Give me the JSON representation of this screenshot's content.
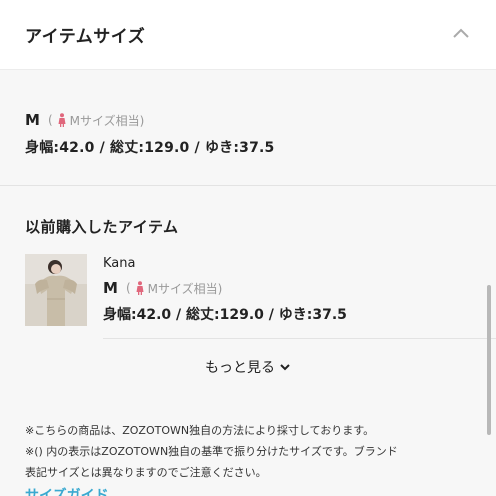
{
  "header": {
    "title": "アイテムサイズ",
    "toggle_icon": "chevron-up-icon"
  },
  "current_size": {
    "size": "M",
    "open_paren": "(",
    "equivalent": "Mサイズ相当)",
    "measurements": "身幅:42.0 / 総丈:129.0 / ゆき:37.5"
  },
  "previous": {
    "title": "以前購入したアイテム",
    "item": {
      "brand": "Kana",
      "size": "M",
      "open_paren": "(",
      "equivalent": "Mサイズ相当)",
      "measurements": "身幅:42.0 / 総丈:129.0 / ゆき:37.5"
    },
    "more_label": "もっと見る"
  },
  "notes": [
    "※こちらの商品は、ZOZOTOWN独自の方法により採寸しております。",
    "※() 内の表示はZOZOTOWN独自の基準で振り分けたサイズです。ブランド",
    "表記サイズとは異なりますのでご注意ください。"
  ],
  "size_guide_link": "サイズガイド",
  "colors": {
    "accent_pink": "#e0677c",
    "link_blue": "#3aa9d0"
  }
}
